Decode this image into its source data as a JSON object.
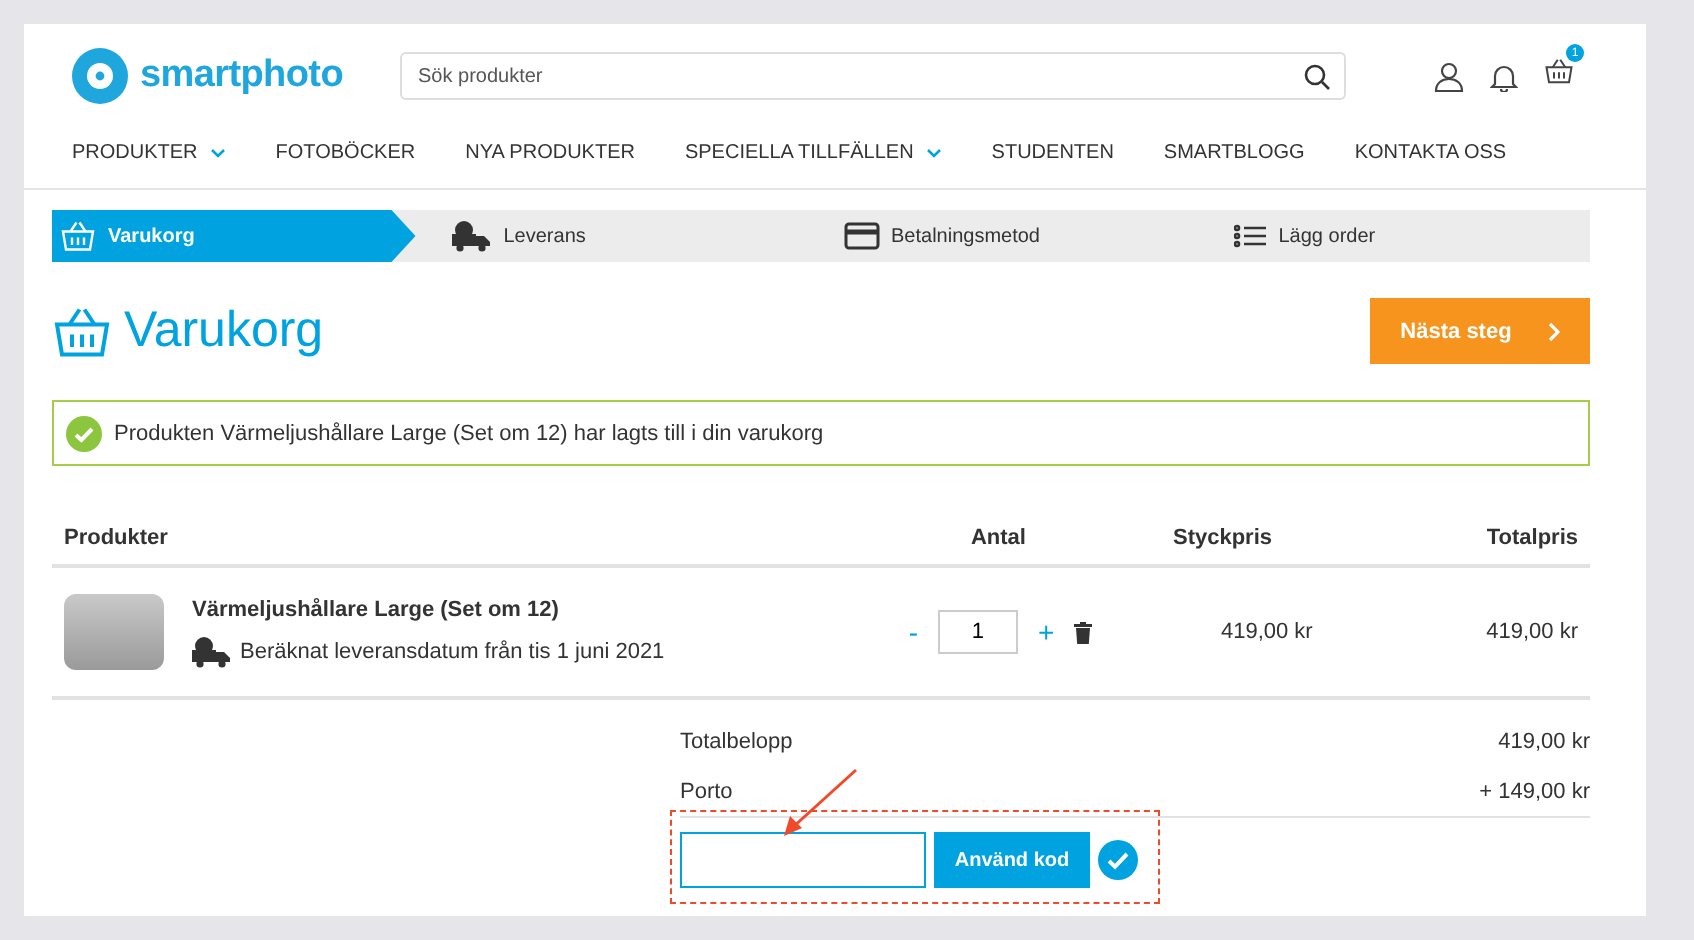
{
  "header": {
    "logo": "smartphoto",
    "search": {
      "placeholder": "Sök produkter"
    },
    "cart_badge": "1"
  },
  "nav": [
    {
      "label": "PRODUKTER",
      "dropdown": true
    },
    {
      "label": "FOTOBÖCKER",
      "dropdown": false
    },
    {
      "label": "NYA PRODUKTER",
      "dropdown": false
    },
    {
      "label": "SPECIELLA TILLFÄLLEN",
      "dropdown": true
    },
    {
      "label": "STUDENTEN",
      "dropdown": false
    },
    {
      "label": "SMARTBLOGG",
      "dropdown": false
    },
    {
      "label": "KONTAKTA OSS",
      "dropdown": false
    }
  ],
  "steps": [
    {
      "label": "Varukorg",
      "selected": true,
      "kind": "basket"
    },
    {
      "label": "Leverans",
      "selected": false,
      "kind": "truck"
    },
    {
      "label": "Betalningsmetod",
      "selected": false,
      "kind": "card"
    },
    {
      "label": "Lägg order",
      "selected": false,
      "kind": "list"
    }
  ],
  "page_title": "Varukorg",
  "next_button": "Nästa steg",
  "alert": "Produkten Värmeljushållare Large (Set om 12) har lagts till i din varukorg",
  "table": {
    "columns": [
      "Produkter",
      "Antal",
      "Styckpris",
      "Totalpris"
    ],
    "rows": [
      {
        "name": "Värmeljushållare Large (Set om 12)",
        "delivery": "Beräknat leveransdatum från tis 1 juni 2021",
        "minus": "-",
        "quantity": "1",
        "plus": "+",
        "unit_price": "419,00 kr",
        "total": "419,00 kr"
      }
    ]
  },
  "summary": [
    {
      "label": "Totalbelopp",
      "value": "419,00 kr"
    },
    {
      "label": "Porto",
      "value": "+ 149,00 kr"
    }
  ],
  "coupon": {
    "button": "Använd kod"
  }
}
